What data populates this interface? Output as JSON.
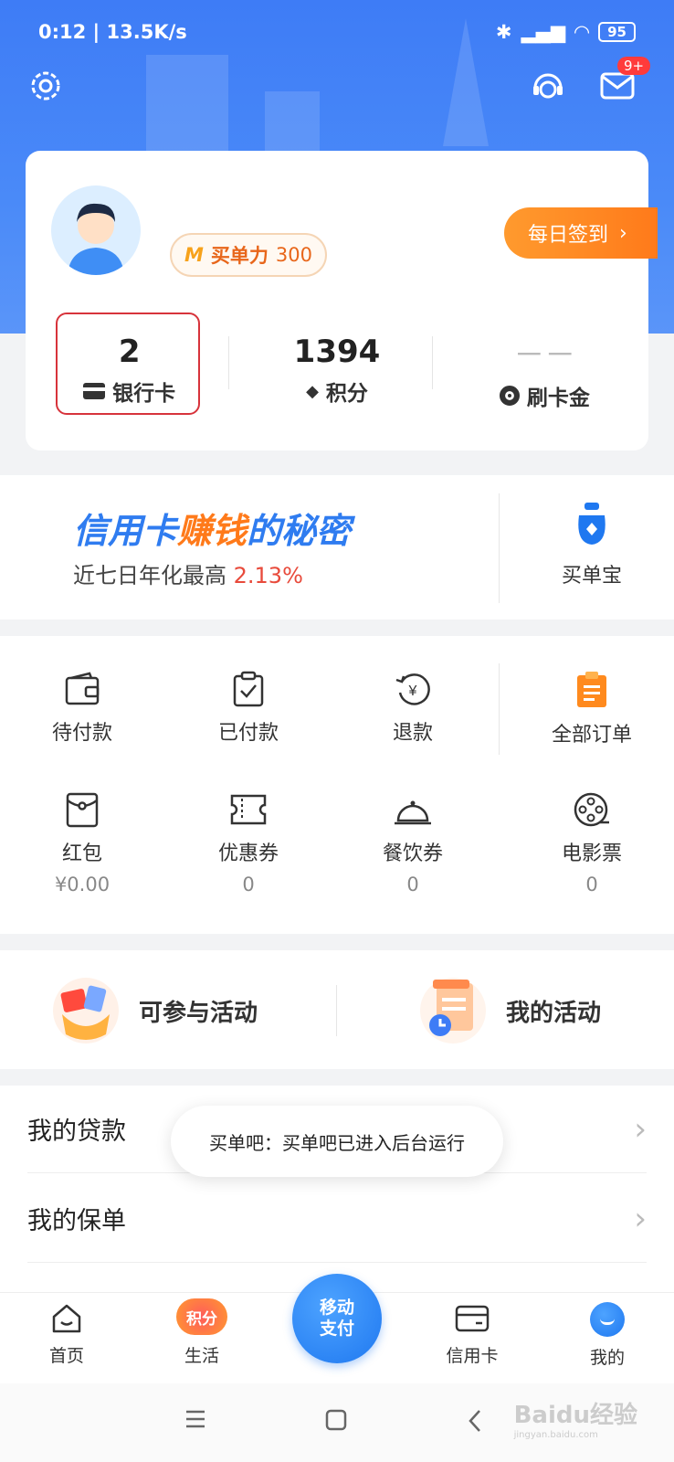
{
  "status_bar": {
    "time_speed": "0:12 | 13.5K/s",
    "battery": "95"
  },
  "header": {
    "message_badge": "9+"
  },
  "profile": {
    "power_prefix": "M",
    "power_label": "买单力",
    "power_value": "300",
    "checkin_label": "每日签到",
    "stats": [
      {
        "value": "2",
        "label": "银行卡"
      },
      {
        "value": "1394",
        "label": "积分"
      },
      {
        "value": "－－",
        "label": "刷卡金"
      }
    ]
  },
  "banner": {
    "title_part1": "信用卡",
    "title_part2": "赚钱",
    "title_part3": "的秘密",
    "subtitle": "近七日年化最高",
    "rate": "2.13%",
    "side_label": "买单宝"
  },
  "orders": [
    {
      "label": "待付款",
      "icon": "wallet-icon"
    },
    {
      "label": "已付款",
      "icon": "clipboard-check-icon"
    },
    {
      "label": "退款",
      "icon": "refund-yen-icon"
    },
    {
      "label": "全部订单",
      "icon": "orders-icon"
    }
  ],
  "assets": [
    {
      "label": "红包",
      "value": "¥0.00",
      "icon": "red-packet-icon"
    },
    {
      "label": "优惠券",
      "value": "0",
      "icon": "coupon-icon"
    },
    {
      "label": "餐饮券",
      "value": "0",
      "icon": "dining-icon"
    },
    {
      "label": "电影票",
      "value": "0",
      "icon": "film-icon"
    }
  ],
  "activities": [
    {
      "label": "可参与活动"
    },
    {
      "label": "我的活动"
    }
  ],
  "list": [
    {
      "label": "我的贷款"
    },
    {
      "label": "我的保单"
    }
  ],
  "toast": "买单吧：买单吧已进入后台运行",
  "tabbar": {
    "tabs": [
      {
        "label": "首页"
      },
      {
        "label": "生活",
        "badge": "积分"
      },
      {
        "label": "信用卡"
      },
      {
        "label": "我的"
      }
    ],
    "pay_line1": "移动",
    "pay_line2": "支付"
  },
  "watermark": {
    "main": "Baidu经验",
    "sub": "jingyan.baidu.com"
  },
  "colors": {
    "brand_blue": "#3e7cf6",
    "orange": "#ff7a1a",
    "selection_red": "#d7333b"
  }
}
